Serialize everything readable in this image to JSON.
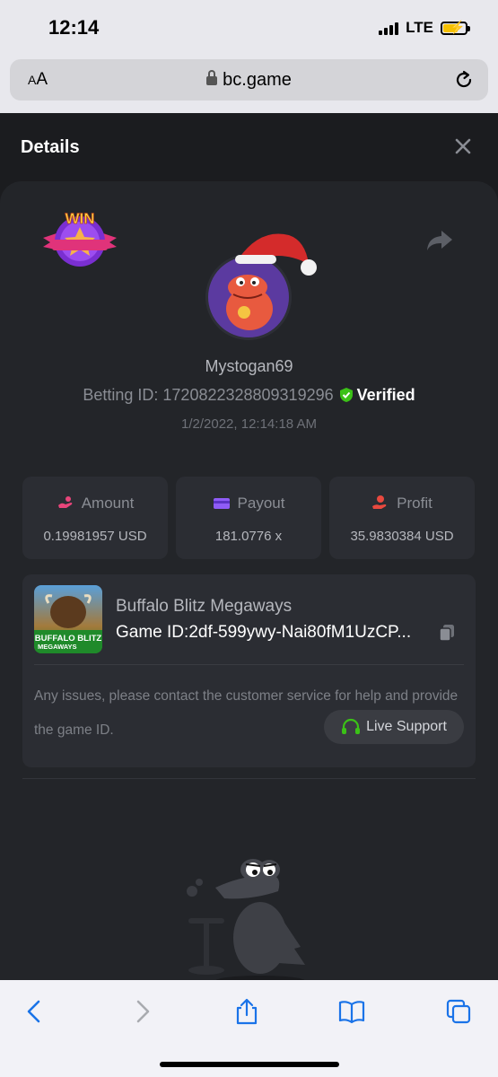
{
  "status_bar": {
    "time": "12:14",
    "network": "LTE"
  },
  "browser": {
    "text_size_label_small": "A",
    "text_size_label_large": "A",
    "url": "bc.game"
  },
  "modal": {
    "title": "Details"
  },
  "badge": {
    "text": "WIN"
  },
  "bet": {
    "username": "Mystogan69",
    "betting_id_label": "Betting ID:",
    "betting_id": "1720822328809319296",
    "verified_label": "Verified",
    "datetime": "1/2/2022, 12:14:18 AM"
  },
  "stats": {
    "amount": {
      "label": "Amount",
      "value": "0.19981957 USD"
    },
    "payout": {
      "label": "Payout",
      "value": "181.0776 x"
    },
    "profit": {
      "label": "Profit",
      "value": "35.9830384 USD"
    }
  },
  "game": {
    "name": "Buffalo Blitz Megaways",
    "id_label": "Game ID:",
    "id": "2df-599ywy-Nai80fM1UzCP...",
    "thumb_line1": "BUFFALO BLITZ",
    "thumb_line2": "MEGAWAYS"
  },
  "support": {
    "help_text": "Any issues, please contact the customer service for help and provide the game ID.",
    "live_support_label": "Live Support"
  },
  "colors": {
    "accent_green": "#3bc117",
    "profit_red": "#e9493f",
    "payout_purple": "#8f5cf7",
    "amount_pink": "#e8457a"
  }
}
